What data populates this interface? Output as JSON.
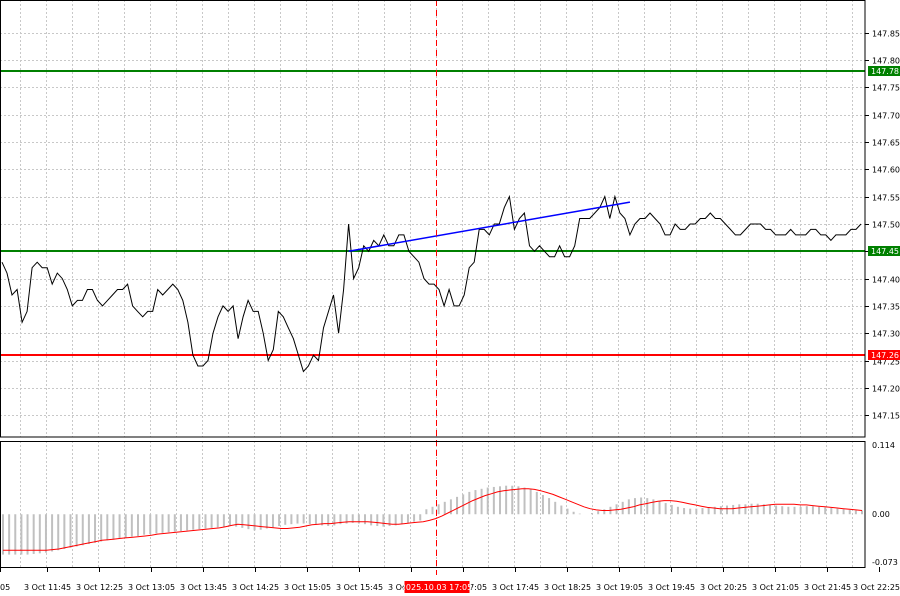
{
  "chart_data": {
    "type": "line",
    "price_panel": {
      "ylim": [
        147.11,
        147.91
      ],
      "y_ticks": [
        "147.85",
        "147.80",
        "147.75",
        "147.70",
        "147.65",
        "147.60",
        "147.55",
        "147.50",
        "147.45",
        "147.40",
        "147.35",
        "147.30",
        "147.25",
        "147.20",
        "147.15"
      ],
      "grid": true,
      "series": [
        {
          "x": [
            0,
            1,
            2,
            3,
            4,
            5,
            6,
            7,
            8,
            9,
            10,
            11,
            12,
            13,
            14,
            15,
            16,
            17,
            18,
            19,
            20,
            21,
            22,
            23,
            24,
            25,
            26,
            27,
            28,
            29,
            30,
            31,
            32,
            33,
            34,
            35,
            36,
            37,
            38,
            39,
            40,
            41,
            42,
            43,
            44,
            45,
            46,
            47,
            48,
            49,
            50,
            51,
            52,
            53,
            54,
            55,
            56,
            57,
            58,
            59,
            60,
            61,
            62,
            63,
            64,
            65,
            66,
            67,
            68,
            69,
            70,
            71,
            72,
            73,
            74,
            75,
            76,
            77,
            78,
            79,
            80,
            81,
            82,
            83,
            84,
            85,
            86,
            87,
            88,
            89,
            90,
            91,
            92,
            93,
            94,
            95,
            96,
            97,
            98,
            99,
            100,
            101,
            102,
            103,
            104,
            105,
            106,
            107,
            108,
            109,
            110,
            111,
            112,
            113,
            114,
            115,
            116,
            117,
            118,
            119,
            120,
            121,
            122,
            123,
            124,
            125,
            126,
            127,
            128,
            129,
            130,
            131,
            132,
            133,
            134,
            135,
            136,
            137,
            138,
            139,
            140,
            141,
            142,
            143,
            144,
            145,
            146,
            147,
            148,
            149,
            150,
            151,
            152,
            153,
            154,
            155,
            156,
            157,
            158,
            159,
            160,
            161,
            162,
            163,
            164,
            165,
            166,
            167,
            168,
            169,
            170,
            171
          ],
          "y": [
            147.43,
            147.41,
            147.37,
            147.38,
            147.32,
            147.34,
            147.42,
            147.43,
            147.42,
            147.42,
            147.39,
            147.41,
            147.4,
            147.38,
            147.35,
            147.36,
            147.36,
            147.38,
            147.38,
            147.36,
            147.35,
            147.36,
            147.37,
            147.38,
            147.38,
            147.39,
            147.35,
            147.34,
            147.33,
            147.34,
            147.34,
            147.38,
            147.37,
            147.38,
            147.39,
            147.38,
            147.36,
            147.32,
            147.26,
            147.24,
            147.24,
            147.25,
            147.3,
            147.33,
            147.35,
            147.34,
            147.35,
            147.29,
            147.33,
            147.36,
            147.34,
            147.34,
            147.3,
            147.25,
            147.27,
            147.34,
            147.33,
            147.31,
            147.29,
            147.26,
            147.23,
            147.24,
            147.26,
            147.25,
            147.31,
            147.34,
            147.37,
            147.3,
            147.38,
            147.5,
            147.4,
            147.42,
            147.46,
            147.45,
            147.47,
            147.46,
            147.48,
            147.46,
            147.46,
            147.48,
            147.48,
            147.45,
            147.44,
            147.43,
            147.4,
            147.39,
            147.39,
            147.38,
            147.35,
            147.38,
            147.35,
            147.35,
            147.37,
            147.42,
            147.43,
            147.49,
            147.49,
            147.48,
            147.5,
            147.5,
            147.53,
            147.55,
            147.49,
            147.51,
            147.52,
            147.46,
            147.45,
            147.46,
            147.45,
            147.44,
            147.44,
            147.46,
            147.44,
            147.44,
            147.46,
            147.51,
            147.51,
            147.51,
            147.52,
            147.53,
            147.55,
            147.51,
            147.55,
            147.52,
            147.51,
            147.48,
            147.5,
            147.51,
            147.51,
            147.52,
            147.51,
            147.5,
            147.48,
            147.48,
            147.5,
            147.49,
            147.49,
            147.5,
            147.5,
            147.51,
            147.51,
            147.52,
            147.51,
            147.51,
            147.5,
            147.49,
            147.48,
            147.48,
            147.49,
            147.5,
            147.5,
            147.5,
            147.49,
            147.49,
            147.48,
            147.48,
            147.48,
            147.49,
            147.48,
            147.48,
            147.48,
            147.49,
            147.49,
            147.48,
            147.48,
            147.47,
            147.48,
            147.48,
            147.48,
            147.49,
            147.49,
            147.5
          ],
          "color": "#000000"
        }
      ],
      "levels": [
        {
          "value": 147.78,
          "label": "147.78",
          "color": "#008000"
        },
        {
          "value": 147.45,
          "label": "147.45",
          "color": "#008000"
        },
        {
          "value": 147.26,
          "label": "147.26",
          "color": "#ff0000"
        }
      ],
      "trendline": {
        "x": [
          69,
          125
        ],
        "y": [
          147.45,
          147.54
        ],
        "color": "#0000ff"
      }
    },
    "oscillator_panel": {
      "ylim": [
        -0.085,
        0.118
      ],
      "y_ticks": [
        "0.114",
        "0.00",
        "-0.073"
      ],
      "histogram": [
        -0.065,
        -0.065,
        -0.065,
        -0.065,
        -0.065,
        -0.064,
        -0.063,
        -0.062,
        -0.06,
        -0.058,
        -0.056,
        -0.054,
        -0.052,
        -0.05,
        -0.048,
        -0.046,
        -0.044,
        -0.042,
        -0.041,
        -0.039,
        -0.038,
        -0.036,
        -0.035,
        -0.033,
        -0.032,
        -0.031,
        -0.03,
        -0.029,
        -0.028,
        -0.027,
        -0.026,
        -0.025,
        -0.024,
        -0.023,
        -0.022,
        -0.021,
        -0.02,
        -0.019,
        -0.02,
        -0.022,
        -0.024,
        -0.026,
        -0.025,
        -0.023,
        -0.021,
        -0.019,
        -0.017,
        -0.016,
        -0.015,
        -0.015,
        -0.016,
        -0.017,
        -0.018,
        -0.019,
        -0.018,
        -0.016,
        -0.015,
        -0.014,
        -0.015,
        -0.016,
        -0.018,
        -0.019,
        -0.02,
        -0.019,
        -0.018,
        -0.016,
        -0.014,
        -0.012,
        -0.01,
        0.008,
        0.012,
        0.016,
        0.02,
        0.024,
        0.028,
        0.032,
        0.036,
        0.039,
        0.041,
        0.043,
        0.044,
        0.045,
        0.046,
        0.046,
        0.045,
        0.043,
        0.04,
        0.036,
        0.031,
        0.026,
        0.02,
        0.014,
        0.009,
        0.004,
        0.001,
        0.0,
        0.002,
        0.005,
        0.008,
        0.012,
        0.016,
        0.02,
        0.024,
        0.026,
        0.027,
        0.026,
        0.024,
        0.021,
        0.018,
        0.015,
        0.012,
        0.01,
        0.009,
        0.009,
        0.01,
        0.011,
        0.012,
        0.013,
        0.014,
        0.015,
        0.016,
        0.016,
        0.017,
        0.017,
        0.016,
        0.015,
        0.014,
        0.013,
        0.012,
        0.012,
        0.012,
        0.013,
        0.013,
        0.012,
        0.011,
        0.01,
        0.009,
        0.008,
        0.007,
        0.006,
        0.006
      ],
      "signal": [
        -0.058,
        -0.058,
        -0.058,
        -0.058,
        -0.058,
        -0.058,
        -0.058,
        -0.058,
        -0.057,
        -0.056,
        -0.054,
        -0.052,
        -0.05,
        -0.048,
        -0.046,
        -0.044,
        -0.042,
        -0.041,
        -0.04,
        -0.039,
        -0.038,
        -0.037,
        -0.036,
        -0.035,
        -0.034,
        -0.032,
        -0.031,
        -0.03,
        -0.029,
        -0.028,
        -0.027,
        -0.026,
        -0.025,
        -0.024,
        -0.023,
        -0.022,
        -0.02,
        -0.018,
        -0.016,
        -0.017,
        -0.018,
        -0.019,
        -0.02,
        -0.021,
        -0.022,
        -0.023,
        -0.023,
        -0.022,
        -0.021,
        -0.019,
        -0.017,
        -0.016,
        -0.015,
        -0.015,
        -0.014,
        -0.013,
        -0.012,
        -0.012,
        -0.012,
        -0.012,
        -0.013,
        -0.014,
        -0.015,
        -0.016,
        -0.016,
        -0.015,
        -0.014,
        -0.013,
        -0.012,
        -0.01,
        -0.007,
        -0.003,
        0.002,
        0.007,
        0.012,
        0.017,
        0.022,
        0.026,
        0.03,
        0.033,
        0.036,
        0.038,
        0.039,
        0.04,
        0.041,
        0.041,
        0.04,
        0.038,
        0.035,
        0.032,
        0.028,
        0.024,
        0.02,
        0.016,
        0.012,
        0.009,
        0.007,
        0.006,
        0.006,
        0.007,
        0.008,
        0.01,
        0.012,
        0.015,
        0.017,
        0.019,
        0.021,
        0.022,
        0.022,
        0.021,
        0.019,
        0.017,
        0.015,
        0.013,
        0.011,
        0.01,
        0.009,
        0.009,
        0.009,
        0.01,
        0.011,
        0.012,
        0.013,
        0.014,
        0.015,
        0.016,
        0.016,
        0.016,
        0.016,
        0.015,
        0.015,
        0.014,
        0.013,
        0.012,
        0.011,
        0.01,
        0.009,
        0.008,
        0.007,
        0.006
      ],
      "histogram_color": "#c0c0c0",
      "signal_color": "#ff0000"
    },
    "x_ticks": [
      "05",
      "3 Oct 11:45",
      "3 Oct 12:25",
      "3 Oct 13:05",
      "3 Oct 13:45",
      "3 Oct 14:25",
      "3 Oct 15:05",
      "3 Oct 15:45",
      "3 Oct 16:25",
      "3 Oct 17:05",
      "3 Oct 17:45",
      "3 Oct 18:25",
      "3 Oct 19:05",
      "3 Oct 19:45",
      "3 Oct 20:25",
      "3 Oct 21:05",
      "3 Oct 21:45",
      "3 Oct 22:25"
    ],
    "cursor": {
      "label": "2025.10.03 17:05",
      "color": "#ff0000"
    },
    "colors": {
      "grid": "#c8c8c8",
      "axis": "#000000",
      "price_line": "#000000"
    }
  }
}
